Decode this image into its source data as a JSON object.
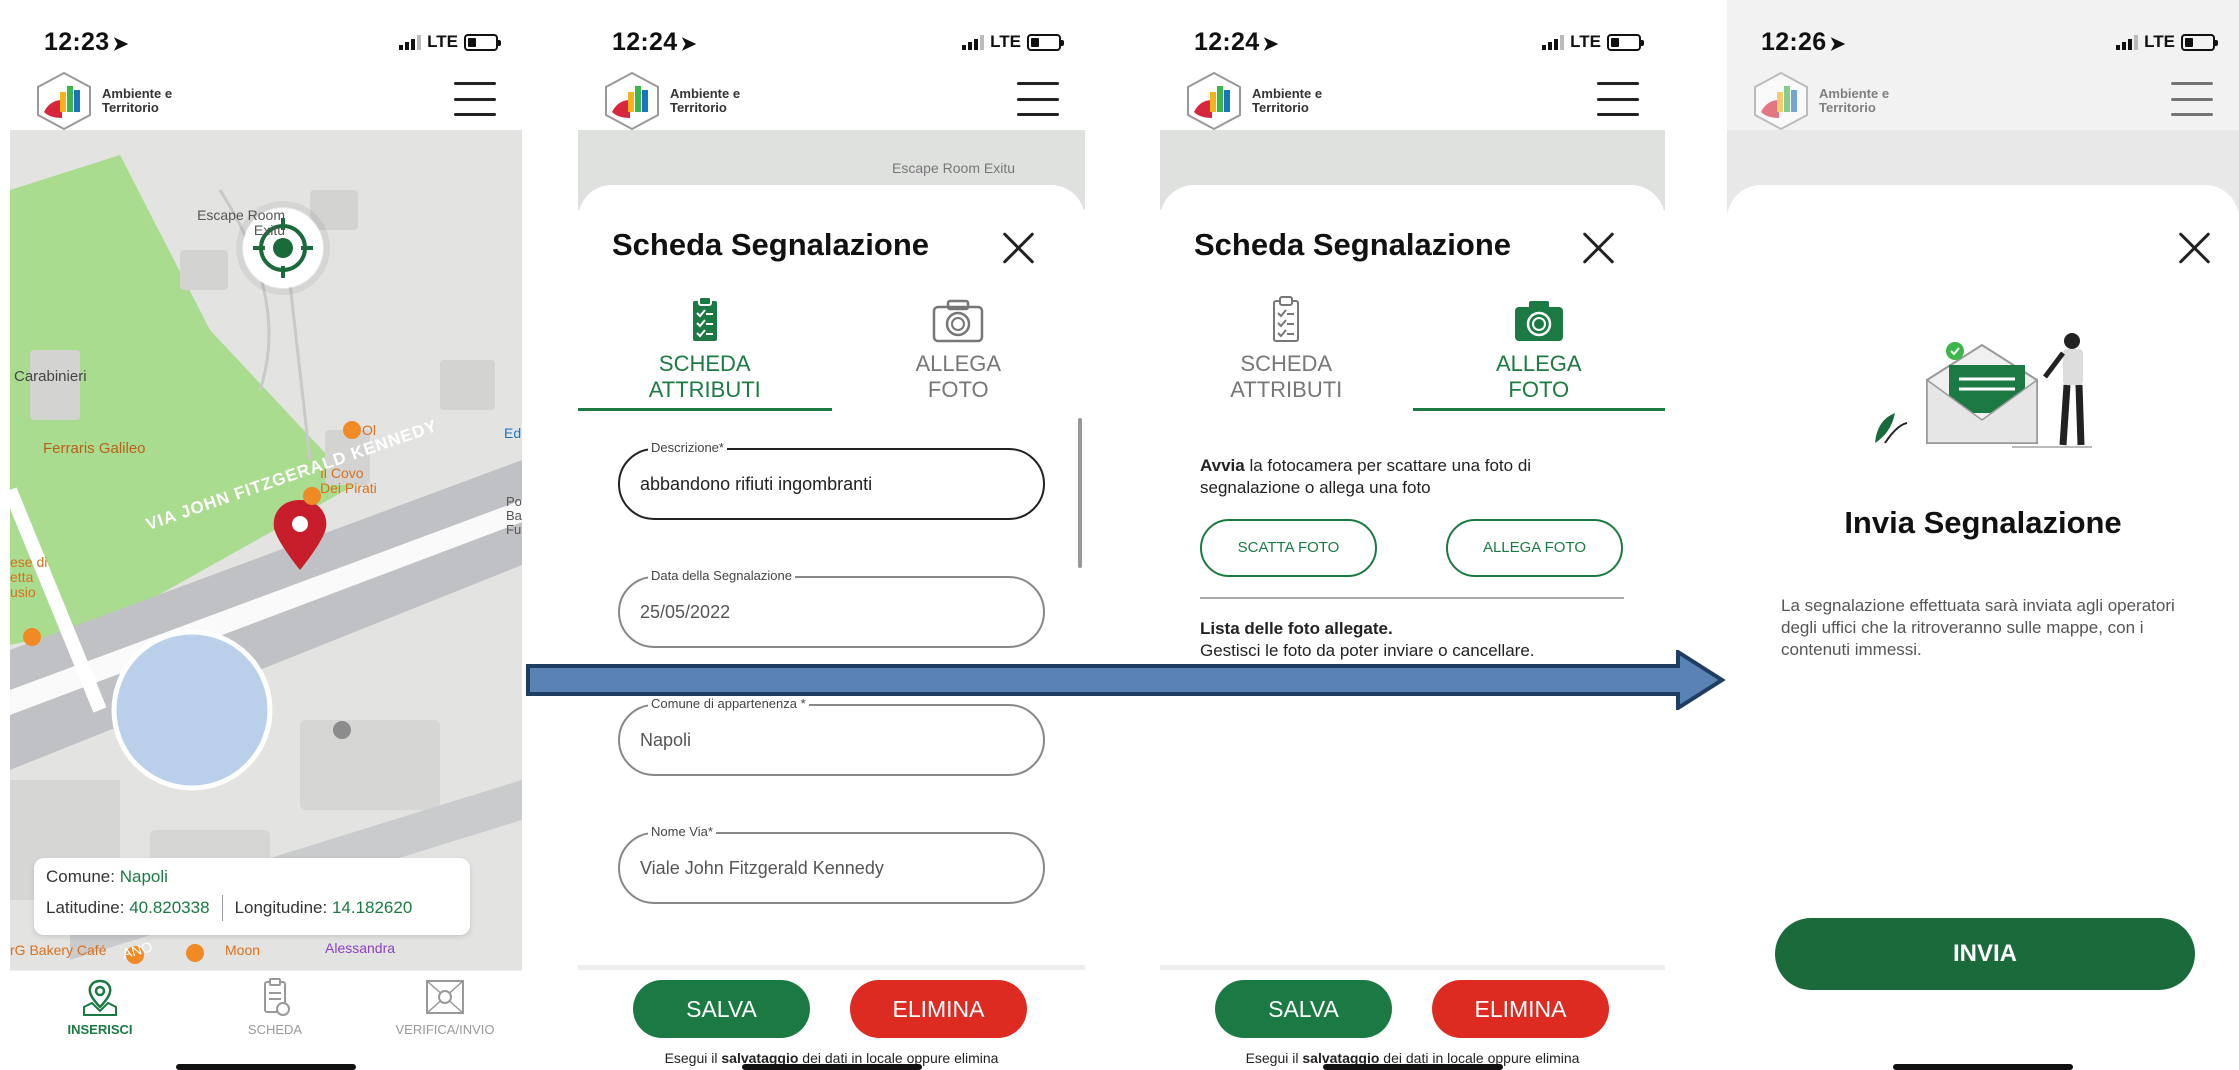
{
  "screens": {
    "map": {
      "time": "12:23",
      "network": "LTE",
      "app_name": "Ambiente e Territorio",
      "map_labels": {
        "escape_room": "Escape Room Exitu",
        "il_covo": "Il Covo Dei Pirati",
        "carabinieri": "Carabinieri",
        "ferraris": "Ferraris Galileo",
        "street": "VIA JOHN FITZGERALD KENNEDY",
        "bakery": "rG Bakery Café",
        "moon": "Moon",
        "alessandra": "Alessandra",
        "ese": "ese di etta usio",
        "ol": "Ol",
        "ed": "Ed",
        "po": "Po Ba Fu",
        "ano": "ANO"
      },
      "info": {
        "comune_label": "Comune:",
        "comune_value": "Napoli",
        "lat_label": "Latitudine:",
        "lat_value": "40.820338",
        "lon_label": "Longitudine:",
        "lon_value": "14.182620"
      },
      "nav": {
        "inserisci": "INSERISCI",
        "scheda": "SCHEDA",
        "verifica": "VERIFICA/INVIO"
      }
    },
    "form": {
      "time": "12:24",
      "network": "LTE",
      "app_name": "Ambiente e Territorio",
      "map_label": "Escape Room Exitu",
      "title": "Scheda Segnalazione",
      "tab1": "SCHEDA ATTRIBUTI",
      "tab2": "ALLEGA FOTO",
      "fields": [
        {
          "label": "Descrizione*",
          "value": "abbandono rifiuti ingombranti"
        },
        {
          "label": "Data della Segnalazione",
          "value": "25/05/2022"
        },
        {
          "label": "Comune di appartenenza *",
          "value": "Napoli"
        },
        {
          "label": "Nome Via*",
          "value": "Viale John Fitzgerald Kennedy"
        }
      ],
      "save": "SALVA",
      "delete": "ELIMINA",
      "hint_pre": "Esegui il ",
      "hint_bold": "salvataggio",
      "hint_post": " dei dati in locale oppure elimina"
    },
    "photo": {
      "time": "12:24",
      "network": "LTE",
      "app_name": "Ambiente e Territorio",
      "title": "Scheda Segnalazione",
      "tab1": "SCHEDA ATTRIBUTI",
      "tab2": "ALLEGA FOTO",
      "intro_bold": "Avvia",
      "intro_rest": " la fotocamera per scattare una foto di segnalazione o allega una foto",
      "scatta": "SCATTA FOTO",
      "allega": "ALLEGA FOTO",
      "list_title": "Lista delle foto allegate.",
      "list_sub": "Gestisci le foto da poter inviare o cancellare.",
      "save": "SALVA",
      "delete": "ELIMINA",
      "hint_pre": "Esegui il ",
      "hint_bold": "salvataggio",
      "hint_post": " dei dati in locale oppure elimina"
    },
    "send": {
      "time": "12:26",
      "network": "LTE",
      "app_name": "Ambiente e Territorio",
      "title": "Invia Segnalazione",
      "body": "La segnalazione effettuata sarà inviata agli operatori degli uffici che la ritroveranno sulle mappe, con i contenuti immessi.",
      "send": "INVIA"
    }
  },
  "colors": {
    "brand_green": "#1b7a43",
    "danger_red": "#dd2b22",
    "dark_green": "#1a6a3c",
    "map_park": "#a9dc8f",
    "map_bg": "#dfe1df"
  }
}
